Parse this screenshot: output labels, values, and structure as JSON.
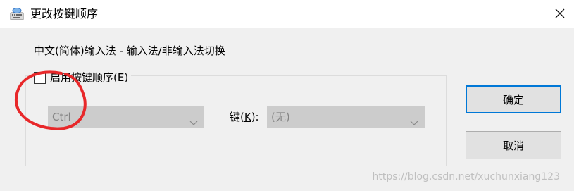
{
  "window": {
    "title": "更改按键顺序",
    "close_glyph": "✕"
  },
  "dialog": {
    "language_label": "中文(简体)输入法 - 输入法/非输入法切换",
    "enable_checkbox": {
      "label_prefix": "启用按键顺序(",
      "label_accel": "E",
      "label_suffix": ")",
      "checked": false
    },
    "modifier_select": {
      "value": "Ctrl"
    },
    "key_label": {
      "prefix": "键(",
      "accel": "K",
      "suffix": "):"
    },
    "key_select": {
      "value": "(无)"
    }
  },
  "buttons": {
    "ok_label": "确定",
    "cancel_label": "取消"
  },
  "watermark": "https://blog.csdn.net/xuchunxiang123",
  "colors": {
    "accent": "#0078d7",
    "annotation": "#e8282a",
    "disabled_bg": "#cccccc",
    "disabled_text": "#838383"
  },
  "icons": {
    "app": "keyboard-icon",
    "close": "close-icon",
    "dropdown": "chevron-down-icon"
  }
}
